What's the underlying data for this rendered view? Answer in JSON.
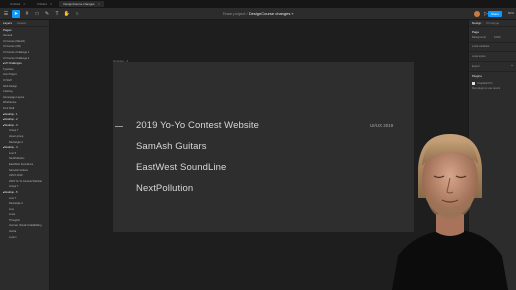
{
  "tabs": [
    {
      "label": "Untitled",
      "active": false
    },
    {
      "label": "Untitled",
      "active": false
    },
    {
      "label": "DesignCourse changes",
      "active": true
    }
  ],
  "toolbar": {
    "team": "Team project",
    "file": "DesignCourse changes",
    "share_label": "Share",
    "zoom": "50%"
  },
  "left_panel": {
    "tabs": [
      "Layers",
      "Assets"
    ],
    "page_label": "Pages",
    "items": [
      {
        "label": "General",
        "indent": 0,
        "header": false
      },
      {
        "label": "UI Course (Sketch)",
        "indent": 0,
        "header": false
      },
      {
        "label": "UI Course (XD)",
        "indent": 0,
        "header": false
      },
      {
        "label": "UI Course Challenge 1",
        "indent": 0,
        "header": false
      },
      {
        "label": "UI Course Challenge 2",
        "indent": 0,
        "header": false
      },
      {
        "label": "UX Challenges",
        "indent": 0,
        "header": true
      },
      {
        "label": "Typeface",
        "indent": 0,
        "header": false
      },
      {
        "label": "Icon Project",
        "indent": 0,
        "header": false
      },
      {
        "label": "UI Stuff",
        "indent": 0,
        "header": false
      },
      {
        "label": "Web Design",
        "indent": 0,
        "header": false
      },
      {
        "label": "Coloring",
        "indent": 0,
        "header": false
      },
      {
        "label": "Homepage Layout",
        "indent": 0,
        "header": false
      },
      {
        "label": "Wireframes",
        "indent": 0,
        "header": false
      },
      {
        "label": "Font Stuff",
        "indent": 0,
        "header": false
      },
      {
        "label": "Desktop - 1",
        "indent": 0,
        "header": true
      },
      {
        "label": "Desktop - 2",
        "indent": 0,
        "header": true
      },
      {
        "label": "Desktop - 3",
        "indent": 0,
        "header": true
      },
      {
        "label": "Group 7",
        "indent": 2,
        "header": false
      },
      {
        "label": "Hover group",
        "indent": 2,
        "header": false
      },
      {
        "label": "Rectangle 2",
        "indent": 2,
        "header": false
      },
      {
        "label": "Desktop - 4",
        "indent": 0,
        "header": true
      },
      {
        "label": "Line 5",
        "indent": 2,
        "header": false
      },
      {
        "label": "NextPollution",
        "indent": 2,
        "header": false
      },
      {
        "label": "EastWest SoundLine",
        "indent": 2,
        "header": false
      },
      {
        "label": "SamAsh Guitars",
        "indent": 2,
        "header": false
      },
      {
        "label": "UI/UX 2019",
        "indent": 2,
        "header": false
      },
      {
        "label": "2019 Yo-Yo Contest Website",
        "indent": 2,
        "header": false
      },
      {
        "label": "Group 7",
        "indent": 2,
        "header": false
      },
      {
        "label": "Desktop - 5",
        "indent": 0,
        "header": true
      },
      {
        "label": "Line 7",
        "indent": 2,
        "header": false
      },
      {
        "label": "Rectangle 2",
        "indent": 2,
        "header": false
      },
      {
        "label": "Line",
        "indent": 2,
        "header": false
      },
      {
        "label": "Lines",
        "indent": 2,
        "header": false
      },
      {
        "label": "Thoughts",
        "indent": 2,
        "header": false
      },
      {
        "label": "Journal, Visual Code/Editing",
        "indent": 2,
        "header": false
      },
      {
        "label": "Inertia",
        "indent": 2,
        "header": false
      },
      {
        "label": "Lorem",
        "indent": 2,
        "header": false
      }
    ]
  },
  "canvas": {
    "frame_label": "Desktop - 4",
    "project_items": [
      "2019 Yo-Yo Contest Website",
      "SamAsh Guitars",
      "EastWest SoundLine",
      "NextPollution"
    ],
    "tag": "UI/UX 2019"
  },
  "right_panel": {
    "tabs": [
      "Design",
      "Prototype"
    ],
    "page_label": "Page",
    "bg_label": "Background",
    "bg_value": "100%",
    "local_styles": "Local variables",
    "local_colors": "Local styles",
    "export": "Export",
    "plugins": "Plugins",
    "plugin_item": "Unsplash Pro",
    "plugin_note": "Run plugin to use recent"
  },
  "colors": {
    "accent": "#0d99ff",
    "canvas": "#1e1e1e",
    "frame": "#2e2e2e",
    "panel": "#2c2c2c"
  }
}
